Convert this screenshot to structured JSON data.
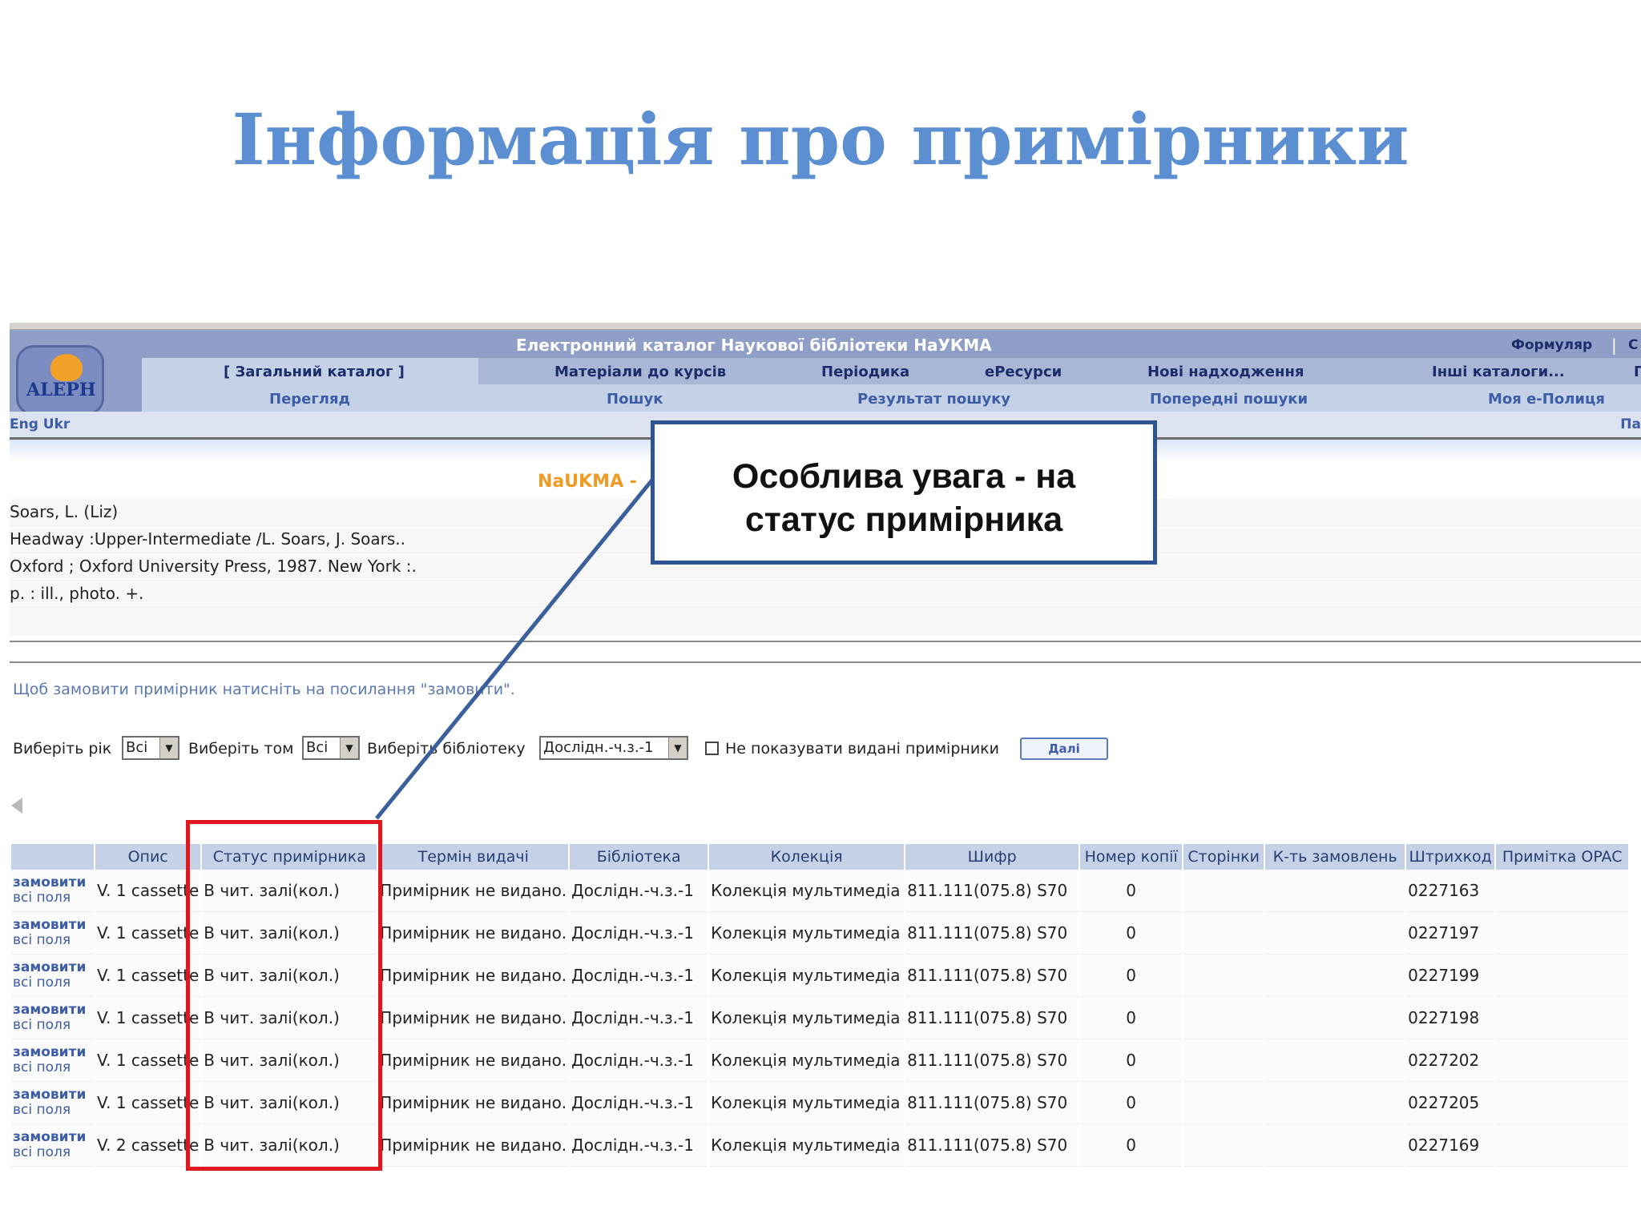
{
  "slide": {
    "title": "Інформація про примірники"
  },
  "header": {
    "title": "Електронний каталог Наукової бібліотеки НаУКМА",
    "formulyar": "Формуляр",
    "separator": "|",
    "right_cut": "С",
    "logo_text": "ALEPH",
    "nav_row1": [
      "[ Загальний каталог ]",
      "Матеріали до курсів",
      "Періодика",
      "еРесурси",
      "Нові надходження",
      "Інші каталоги...",
      "П"
    ],
    "nav_row2": [
      "Перегляд",
      "Пошук",
      "Результат пошуку",
      "Попередні пошуки",
      "Моя е-Полиця"
    ],
    "lang": "Eng Ukr",
    "lang_right": "Па"
  },
  "naukma_cut": "NaUKMA - ",
  "record": {
    "author": "Soars, L. (Liz)",
    "title_line": "Headway :Upper-Intermediate /L. Soars, J. Soars..",
    "publisher": " Oxford ; Oxford University Press, 1987. New York :.",
    "extent": " p. : ill., photo. +."
  },
  "hint": "Щоб замовити примірник натисніть на посилання \"замовити\".",
  "filters": {
    "year_label": "Виберіть рік",
    "year_value": "Всі",
    "volume_label": "Виберіть том",
    "volume_value": "Всі",
    "library_label": "Виберіть бібліотеку",
    "library_value": "Дослідн.-ч.з.-1",
    "hide_label": "Не показувати видані примірники",
    "next_button": "Далі"
  },
  "table": {
    "headers": [
      "",
      "Опис",
      "Статус примірника",
      "Термін видачі",
      "Бібліотека",
      "Колекція",
      "Шифр",
      "Номер копії",
      "Сторінки",
      "К-ть замовлень",
      "Штрихкод",
      "Примітка OPAC"
    ],
    "order_label": "замовити",
    "all_fields_label": "всі поля",
    "rows": [
      {
        "desc": "V. 1 cassette",
        "status": "В чит. залі(кол.)",
        "due": "Примірник не видано.",
        "library": "Дослідн.-ч.з.-1",
        "collection": "Колекція мультимедіа",
        "shelfmark": "811.111(075.8) S70",
        "copy": "0",
        "barcode": "0227163"
      },
      {
        "desc": "V. 1 cassette",
        "status": "В чит. залі(кол.)",
        "due": "Примірник не видано.",
        "library": "Дослідн.-ч.з.-1",
        "collection": "Колекція мультимедіа",
        "shelfmark": "811.111(075.8) S70",
        "copy": "0",
        "barcode": "0227197"
      },
      {
        "desc": "V. 1 cassette",
        "status": "В чит. залі(кол.)",
        "due": "Примірник не видано.",
        "library": "Дослідн.-ч.з.-1",
        "collection": "Колекція мультимедіа",
        "shelfmark": "811.111(075.8) S70",
        "copy": "0",
        "barcode": "0227199"
      },
      {
        "desc": "V. 1 cassette",
        "status": "В чит. залі(кол.)",
        "due": "Примірник не видано.",
        "library": "Дослідн.-ч.з.-1",
        "collection": "Колекція мультимедіа",
        "shelfmark": "811.111(075.8) S70",
        "copy": "0",
        "barcode": "0227198"
      },
      {
        "desc": "V. 1 cassette",
        "status": "В чит. залі(кол.)",
        "due": "Примірник не видано.",
        "library": "Дослідн.-ч.з.-1",
        "collection": "Колекція мультимедіа",
        "shelfmark": "811.111(075.8) S70",
        "copy": "0",
        "barcode": "0227202"
      },
      {
        "desc": "V. 1 cassette",
        "status": "В чит. залі(кол.)",
        "due": "Примірник не видано.",
        "library": "Дослідн.-ч.з.-1",
        "collection": "Колекція мультимедіа",
        "shelfmark": "811.111(075.8) S70",
        "copy": "0",
        "barcode": "0227205"
      },
      {
        "desc": "V. 2 cassette",
        "status": "В чит. залі(кол.)",
        "due": "Примірник не видано.",
        "library": "Дослідн.-ч.з.-1",
        "collection": "Колекція мультимедіа",
        "shelfmark": "811.111(075.8) S70",
        "copy": "0",
        "barcode": "0227169"
      }
    ]
  },
  "callout": {
    "line1": "Особлива увага - на",
    "line2": "статус примірника"
  },
  "colors": {
    "title": "#5b8fd2",
    "highlight": "#e0181e",
    "callout_border": "#2e5494"
  }
}
